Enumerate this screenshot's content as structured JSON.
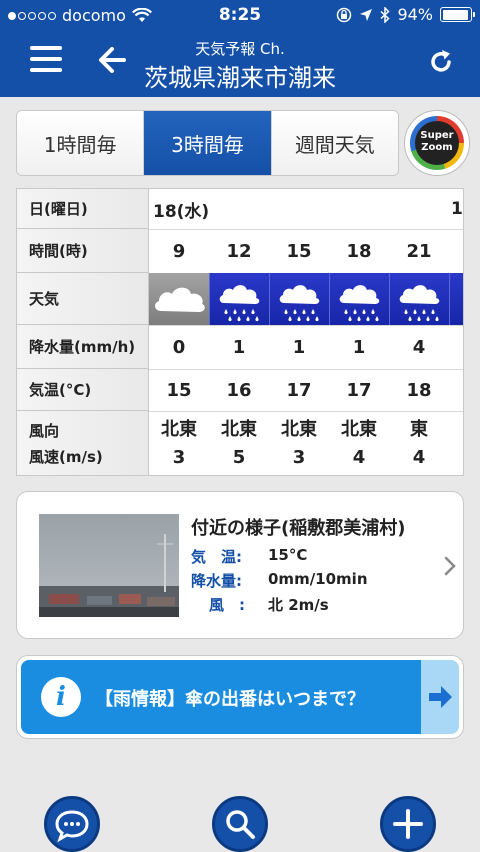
{
  "status_bar": {
    "carrier": "docomo",
    "time": "8:25",
    "battery": "94%",
    "battery_level": 0.94
  },
  "header": {
    "subtitle": "天気予報 Ch.",
    "title": "茨城県潮来市潮来",
    "icons": [
      "menu-icon",
      "back-arrow-icon",
      "reload-icon"
    ]
  },
  "tabs": [
    {
      "label": "1時間毎",
      "active": false
    },
    {
      "label": "3時間毎",
      "active": true
    },
    {
      "label": "週間天気",
      "active": false
    }
  ],
  "super_zoom": {
    "line1": "Super",
    "line2": "Zoom"
  },
  "forecast": {
    "labels": {
      "date": "日(曜日)",
      "time": "時間(時)",
      "weather": "天気",
      "precip": "降水量(mm/h)",
      "temp": "気温(°C)",
      "wind_dir": "風向",
      "wind_speed": "風速(m/s)"
    },
    "date": "18(水)",
    "next_date_partial": "1",
    "columns": [
      {
        "time": "9",
        "weather": "cloudy",
        "precip": "0",
        "temp": "15",
        "wind_dir": "北東",
        "wind_speed": "3"
      },
      {
        "time": "12",
        "weather": "rain",
        "precip": "1",
        "temp": "16",
        "wind_dir": "北東",
        "wind_speed": "5"
      },
      {
        "time": "15",
        "weather": "rain",
        "precip": "1",
        "temp": "17",
        "wind_dir": "北東",
        "wind_speed": "3"
      },
      {
        "time": "18",
        "weather": "rain",
        "precip": "1",
        "temp": "17",
        "wind_dir": "北東",
        "wind_speed": "4"
      },
      {
        "time": "21",
        "weather": "rain",
        "precip": "4",
        "temp": "18",
        "wind_dir": "東",
        "wind_speed": "4"
      }
    ]
  },
  "nearby": {
    "title": "付近の様子(稲敷郡美浦村)",
    "rows": [
      {
        "key": "気　温:",
        "value": "15°C"
      },
      {
        "key": "降水量:",
        "value": "0mm/10min"
      },
      {
        "key": "風　:",
        "value": "北 2m/s"
      }
    ]
  },
  "banner": {
    "icon_letter": "i",
    "text": "【雨情報】傘の出番はいつまで？"
  },
  "bottom_buttons": [
    "chat-icon",
    "search-icon",
    "plus-icon"
  ]
}
